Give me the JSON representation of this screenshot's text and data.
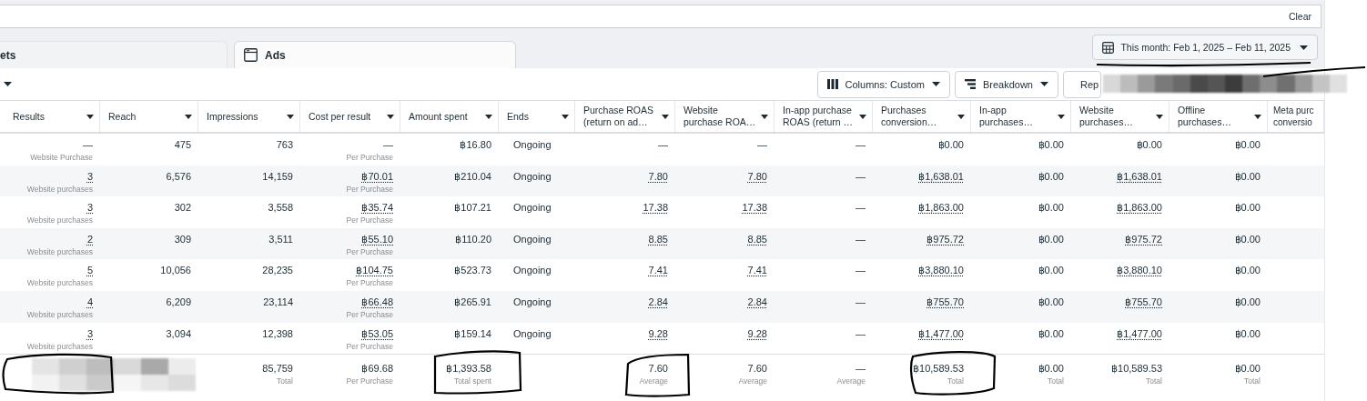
{
  "search": {
    "clear": "Clear"
  },
  "tabs": [
    {
      "label": "ets",
      "selected": false,
      "icon": false
    },
    {
      "label": "Ads",
      "selected": true,
      "icon": true
    }
  ],
  "date_button": "This month: Feb 1, 2025 – Feb 11, 2025",
  "toolbar": [
    {
      "label": "Columns: Custom",
      "kind": "columns"
    },
    {
      "label": "Breakdown",
      "kind": "breakdown"
    },
    {
      "label": "Rep",
      "kind": "reports"
    }
  ],
  "table": {
    "columns": [
      {
        "label": "Results",
        "kind": "number"
      },
      {
        "label": "Reach",
        "kind": "number"
      },
      {
        "label": "Impressions",
        "kind": "number"
      },
      {
        "label": "Cost per result",
        "kind": "number"
      },
      {
        "label": "Amount spent",
        "kind": "number"
      },
      {
        "label": "Ends",
        "kind": "text"
      },
      {
        "label": "Purchase ROAS (return on ad…",
        "kind": "number"
      },
      {
        "label": "Website purchase ROA…",
        "kind": "number"
      },
      {
        "label": "In-app purchase ROAS (return …",
        "kind": "number"
      },
      {
        "label": "Purchases conversion…",
        "kind": "number"
      },
      {
        "label": "In-app purchases…",
        "kind": "number"
      },
      {
        "label": "Website purchases…",
        "kind": "number"
      },
      {
        "label": "Offline purchases…",
        "kind": "number"
      },
      {
        "label": "Meta purc conversio",
        "kind": "number"
      }
    ],
    "rows": [
      {
        "cells": [
          {
            "text": "—",
            "sub": "Website Purchase",
            "link": false
          },
          {
            "text": "475",
            "link": false
          },
          {
            "text": "763",
            "link": false
          },
          {
            "text": "—",
            "sub": "Per Purchase",
            "link": false
          },
          {
            "text": "฿16.80",
            "link": false
          },
          {
            "text": "Ongoing",
            "link": false
          },
          {
            "text": "—",
            "link": false
          },
          {
            "text": "—",
            "link": false
          },
          {
            "text": "—",
            "link": false
          },
          {
            "text": "฿0.00",
            "link": false
          },
          {
            "text": "฿0.00",
            "link": false
          },
          {
            "text": "฿0.00",
            "link": false
          },
          {
            "text": "฿0.00",
            "link": false
          }
        ]
      },
      {
        "cells": [
          {
            "text": "3",
            "sub": "Website purchases",
            "link": true
          },
          {
            "text": "6,576",
            "link": false
          },
          {
            "text": "14,159",
            "link": false
          },
          {
            "text": "฿70.01",
            "sub": "Per Purchase",
            "link": true
          },
          {
            "text": "฿210.04",
            "link": false
          },
          {
            "text": "Ongoing",
            "link": false
          },
          {
            "text": "7.80",
            "link": true
          },
          {
            "text": "7.80",
            "link": true
          },
          {
            "text": "—",
            "link": false
          },
          {
            "text": "฿1,638.01",
            "link": true
          },
          {
            "text": "฿0.00",
            "link": false
          },
          {
            "text": "฿1,638.01",
            "link": true
          },
          {
            "text": "฿0.00",
            "link": false
          }
        ]
      },
      {
        "cells": [
          {
            "text": "3",
            "sub": "Website purchases",
            "link": true
          },
          {
            "text": "302",
            "link": false
          },
          {
            "text": "3,558",
            "link": false
          },
          {
            "text": "฿35.74",
            "sub": "Per Purchase",
            "link": true
          },
          {
            "text": "฿107.21",
            "link": false
          },
          {
            "text": "Ongoing",
            "link": false
          },
          {
            "text": "17.38",
            "link": true
          },
          {
            "text": "17.38",
            "link": true
          },
          {
            "text": "—",
            "link": false
          },
          {
            "text": "฿1,863.00",
            "link": true
          },
          {
            "text": "฿0.00",
            "link": false
          },
          {
            "text": "฿1,863.00",
            "link": true
          },
          {
            "text": "฿0.00",
            "link": false
          }
        ]
      },
      {
        "cells": [
          {
            "text": "2",
            "sub": "Website purchases",
            "link": true
          },
          {
            "text": "309",
            "link": false
          },
          {
            "text": "3,511",
            "link": false
          },
          {
            "text": "฿55.10",
            "sub": "Per Purchase",
            "link": true
          },
          {
            "text": "฿110.20",
            "link": false
          },
          {
            "text": "Ongoing",
            "link": false
          },
          {
            "text": "8.85",
            "link": true
          },
          {
            "text": "8.85",
            "link": true
          },
          {
            "text": "—",
            "link": false
          },
          {
            "text": "฿975.72",
            "link": true
          },
          {
            "text": "฿0.00",
            "link": false
          },
          {
            "text": "฿975.72",
            "link": true
          },
          {
            "text": "฿0.00",
            "link": false
          }
        ]
      },
      {
        "cells": [
          {
            "text": "5",
            "sub": "Website purchases",
            "link": true
          },
          {
            "text": "10,056",
            "link": false
          },
          {
            "text": "28,235",
            "link": false
          },
          {
            "text": "฿104.75",
            "sub": "Per Purchase",
            "link": true
          },
          {
            "text": "฿523.73",
            "link": false
          },
          {
            "text": "Ongoing",
            "link": false
          },
          {
            "text": "7.41",
            "link": true
          },
          {
            "text": "7.41",
            "link": true
          },
          {
            "text": "—",
            "link": false
          },
          {
            "text": "฿3,880.10",
            "link": true
          },
          {
            "text": "฿0.00",
            "link": false
          },
          {
            "text": "฿3,880.10",
            "link": true
          },
          {
            "text": "฿0.00",
            "link": false
          }
        ]
      },
      {
        "cells": [
          {
            "text": "4",
            "sub": "Website purchases",
            "link": true
          },
          {
            "text": "6,209",
            "link": false
          },
          {
            "text": "23,114",
            "link": false
          },
          {
            "text": "฿66.48",
            "sub": "Per Purchase",
            "link": true
          },
          {
            "text": "฿265.91",
            "link": false
          },
          {
            "text": "Ongoing",
            "link": false
          },
          {
            "text": "2.84",
            "link": true
          },
          {
            "text": "2.84",
            "link": true
          },
          {
            "text": "—",
            "link": false
          },
          {
            "text": "฿755.70",
            "link": true
          },
          {
            "text": "฿0.00",
            "link": false
          },
          {
            "text": "฿755.70",
            "link": true
          },
          {
            "text": "฿0.00",
            "link": false
          }
        ]
      },
      {
        "cells": [
          {
            "text": "3",
            "sub": "Website purchases",
            "link": true
          },
          {
            "text": "3,094",
            "link": false
          },
          {
            "text": "12,398",
            "link": false
          },
          {
            "text": "฿53.05",
            "sub": "Per Purchase",
            "link": true
          },
          {
            "text": "฿159.14",
            "link": false
          },
          {
            "text": "Ongoing",
            "link": false
          },
          {
            "text": "9.28",
            "link": true
          },
          {
            "text": "9.28",
            "link": true
          },
          {
            "text": "—",
            "link": false
          },
          {
            "text": "฿1,477.00",
            "link": true
          },
          {
            "text": "฿0.00",
            "link": false
          },
          {
            "text": "฿1,477.00",
            "link": true
          },
          {
            "text": "฿0.00",
            "link": false
          }
        ]
      }
    ],
    "totals": [
      {
        "kind": "redacted"
      },
      {
        "kind": "redacted"
      },
      {
        "kind": "value",
        "text": "85,759",
        "sub": "Total"
      },
      {
        "kind": "value",
        "text": "฿69.68",
        "sub": "Per Purchase"
      },
      {
        "kind": "value",
        "text": "฿1,393.58",
        "sub": "Total spent"
      },
      {
        "kind": "blank"
      },
      {
        "kind": "value",
        "text": "7.60",
        "sub": "Average"
      },
      {
        "kind": "value",
        "text": "7.60",
        "sub": "Average"
      },
      {
        "kind": "value",
        "text": "—",
        "sub": "Average"
      },
      {
        "kind": "value",
        "text": "฿10,589.53",
        "sub": "Total"
      },
      {
        "kind": "value",
        "text": "฿0.00",
        "sub": "Total"
      },
      {
        "kind": "value",
        "text": "฿10,589.53",
        "sub": "Total"
      },
      {
        "kind": "value",
        "text": "฿0.00",
        "sub": "Total"
      },
      {
        "kind": "blank"
      }
    ]
  }
}
